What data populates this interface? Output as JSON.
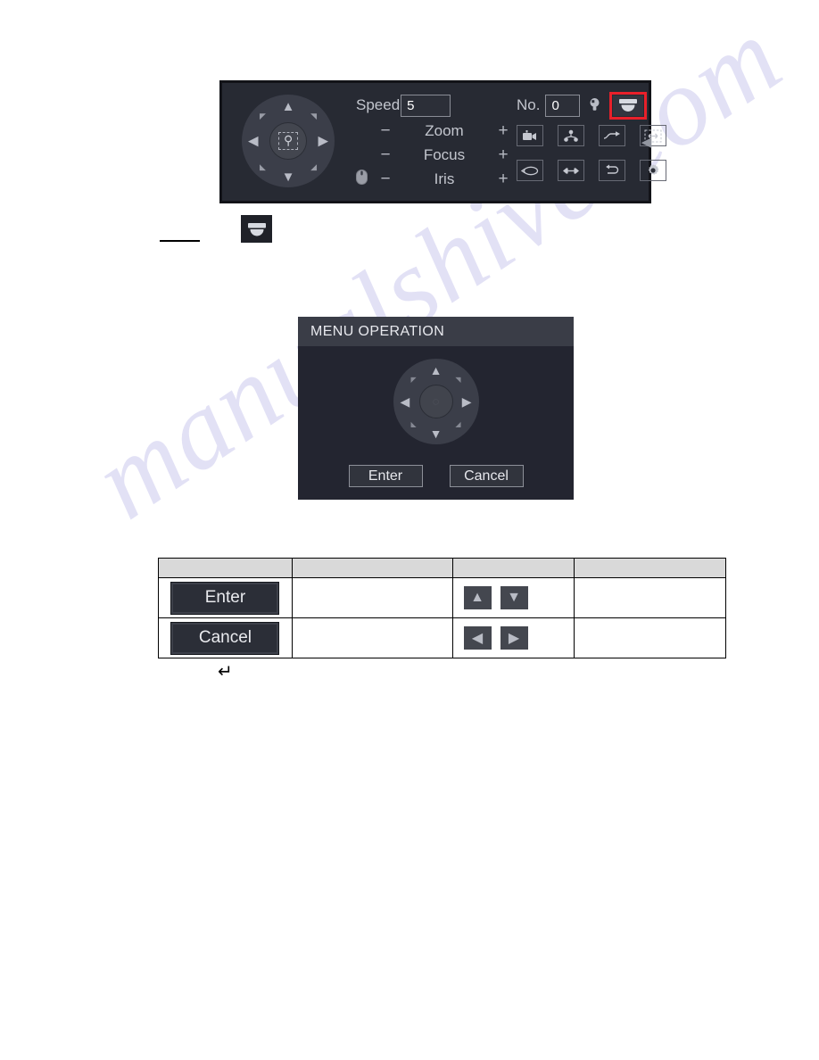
{
  "watermark": {
    "text": "manualshive.com",
    "color": "#5b52c8"
  },
  "ptz_panel": {
    "joystick": {
      "up": "▲",
      "down": "▼",
      "left": "◀",
      "right": "▶",
      "up_left": "◤",
      "up_right": "◥",
      "down_left": "◣",
      "down_right": "◢",
      "center_icon": "zoom-search-icon",
      "center_glyph": "⌕"
    },
    "speed": {
      "label": "Speed",
      "value": "5"
    },
    "no": {
      "label": "No.",
      "value": "0"
    },
    "adjust_rows": [
      {
        "label": "Zoom",
        "minus": "−",
        "plus": "+"
      },
      {
        "label": "Focus",
        "minus": "−",
        "plus": "+"
      },
      {
        "label": "Iris",
        "minus": "−",
        "plus": "+"
      }
    ],
    "mouse_icon": "mouse-icon",
    "light_icon": "light-bulb-icon",
    "dome_button": {
      "icon": "dome-camera-icon",
      "highlighted": true,
      "highlight_color": "#e8202a"
    },
    "icon_grid": [
      {
        "name": "preset-camera-icon"
      },
      {
        "name": "scan-pattern-icon"
      },
      {
        "name": "tour-arrow-icon"
      },
      {
        "name": "auto-pan-frame-icon"
      },
      {
        "name": "rotate-loop-icon"
      },
      {
        "name": "horizontal-pan-icon"
      },
      {
        "name": "flip-undo-icon"
      },
      {
        "name": "settings-gear-icon"
      }
    ],
    "collapse_handle": {
      "icon": "collapse-left-icon",
      "glyph": "◀"
    }
  },
  "inline_dome": {
    "icon": "dome-camera-icon"
  },
  "dialog": {
    "title": "MENU OPERATION",
    "joystick": {
      "up": "▲",
      "down": "▼",
      "left": "◀",
      "right": "▶",
      "up_left": "◤",
      "up_right": "◥",
      "down_left": "◣",
      "down_right": "◢",
      "center_glyph": "○"
    },
    "buttons": [
      {
        "label": "Enter"
      },
      {
        "label": "Cancel"
      }
    ]
  },
  "table": {
    "headers": [
      "",
      "",
      "",
      ""
    ],
    "rows": [
      {
        "button_label": "Enter",
        "col2": "",
        "arrows": [
          {
            "name": "arrow-up-key",
            "glyph": "▲"
          },
          {
            "name": "arrow-down-key",
            "glyph": "▼"
          }
        ],
        "col4": ""
      },
      {
        "button_label": "Cancel",
        "col2": "",
        "arrows": [
          {
            "name": "arrow-left-key",
            "glyph": "◀"
          },
          {
            "name": "arrow-right-key",
            "glyph": "▶"
          }
        ],
        "col4": ""
      }
    ]
  },
  "pilcrow": {
    "glyph": "↵"
  }
}
